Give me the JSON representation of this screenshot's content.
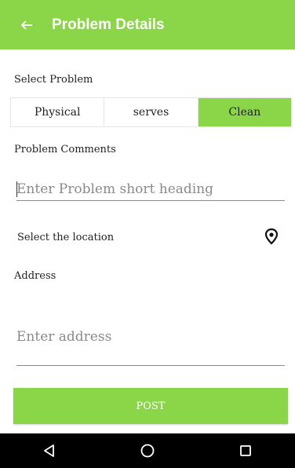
{
  "appbar": {
    "title": "Problem Details",
    "back_icon": "arrow-left-icon"
  },
  "select_problem": {
    "label": "Select Problem",
    "options": [
      {
        "label": "Physical",
        "selected": false
      },
      {
        "label": "serves",
        "selected": false
      },
      {
        "label": "Clean",
        "selected": true
      }
    ]
  },
  "problem_comments": {
    "label": "Problem Comments",
    "placeholder": "Enter Problem short heading",
    "value": ""
  },
  "location": {
    "label": "Select the location",
    "icon": "location-pin-icon"
  },
  "address": {
    "label": "Address",
    "placeholder": "Enter address",
    "value": ""
  },
  "post_button": {
    "label": "POST"
  },
  "system_nav": {
    "back": "nav-back-icon",
    "home": "nav-home-icon",
    "recents": "nav-recents-icon"
  },
  "colors": {
    "accent": "#8bd548",
    "navbar": "#000000",
    "text": "#222222"
  }
}
